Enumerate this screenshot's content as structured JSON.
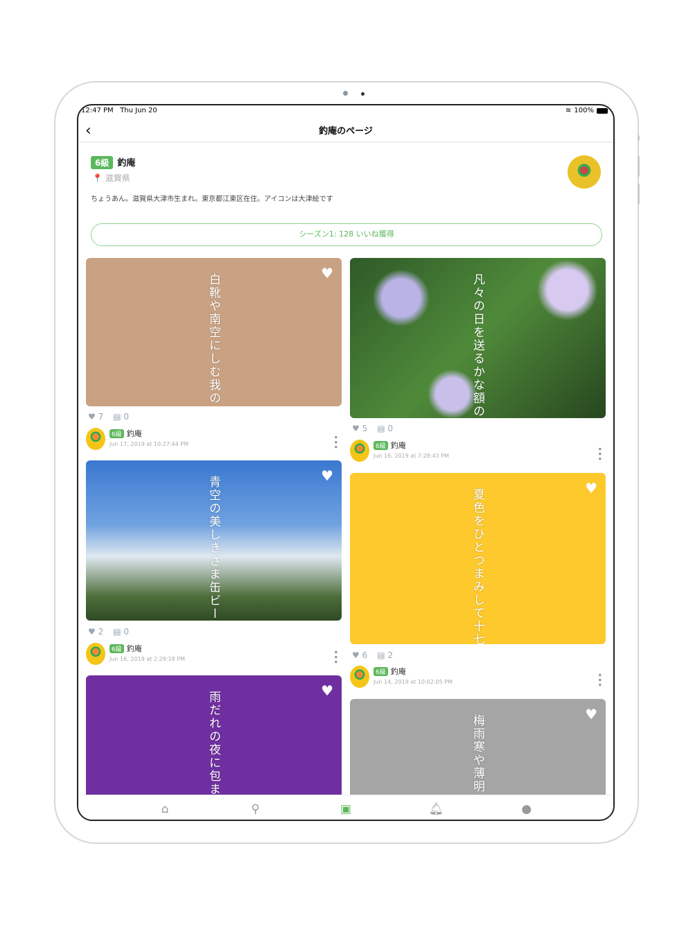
{
  "status": {
    "time": "12:47 PM",
    "date": "Thu Jun 20",
    "battery": "100%"
  },
  "nav": {
    "title": "釣庵のページ",
    "back": "‹"
  },
  "profile": {
    "level": "6級",
    "name": "釣庵",
    "location": "滋賀県",
    "bio": "ちょうあん。滋賀県大津市生まれ。東京都江東区在住。アイコンは大津絵です",
    "season": "シーズン1:  128 いいね獲得"
  },
  "posts": [
    {
      "poem": "白靴や南空にしむ我の",
      "likes": "7",
      "comments": "0",
      "user": "釣庵",
      "level": "6級",
      "date": "Jun 17, 2019 at 10:27:44 PM",
      "color": "#c9a283"
    },
    {
      "poem": "凡々の日を送るかな額の",
      "likes": "5",
      "comments": "0",
      "user": "釣庵",
      "level": "6級",
      "date": "Jun 16, 2019 at 7:28:43 PM"
    },
    {
      "poem": "青空の美しきさま缶ビー",
      "likes": "2",
      "comments": "0",
      "user": "釣庵",
      "level": "6級",
      "date": "Jun 16, 2019 at 2:29:18 PM"
    },
    {
      "poem": "夏色をひとつまみして十七",
      "likes": "6",
      "comments": "2",
      "user": "釣庵",
      "level": "6級",
      "date": "Jun 14, 2019 at 10:02:05 PM",
      "color": "#fdc92d"
    },
    {
      "poem": "雨だれの夜に包まれ",
      "color": "#6f2fa0"
    },
    {
      "poem": "梅雨寒や薄明け",
      "color": "#a5a5a5"
    }
  ],
  "tabs": [
    "home",
    "search",
    "camera",
    "notifications",
    "profile"
  ],
  "accent": "#5cb85c"
}
